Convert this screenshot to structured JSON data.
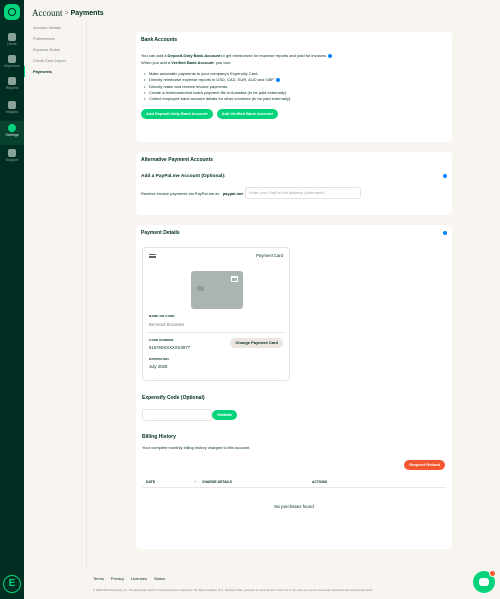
{
  "colors": {
    "accent": "#03d47c",
    "danger": "#f25730",
    "dark": "#002e22",
    "background": "#f8f4f0"
  },
  "nav": {
    "items": [
      {
        "label": "Home",
        "icon": "home-icon"
      },
      {
        "label": "Expenses",
        "icon": "receipt-icon"
      },
      {
        "label": "Reports",
        "icon": "document-icon"
      },
      {
        "label": "Insights",
        "icon": "lightbulb-icon"
      },
      {
        "label": "Settings",
        "icon": "gear-icon",
        "active": true
      },
      {
        "label": "Support",
        "icon": "chat-icon"
      }
    ]
  },
  "header": {
    "section": "Account",
    "separator": ">",
    "page": "Payments"
  },
  "submenu": [
    "Account Details",
    "Preferences",
    "Expense Rules",
    "Credit Card Import",
    "Payments"
  ],
  "bank": {
    "title": "Bank Accounts",
    "line1_a": "You can add a ",
    "line1_b": "Deposit-Only Bank Account",
    "line1_c": " to get reimbursed for expense reports and paid for invoices.",
    "line2_a": "When you add a ",
    "line2_b": "Verified Bank Account",
    "line2_c": ", you can:",
    "bullets": [
      "Make automatic payments to your company's Expensify Card.",
      "Directly reimburse expense reports in USD, CAD, EUR, AUD and GBP",
      "Directly make and receive invoice payments.",
      "Create a reimbursement batch payment file in Australia (to be paid externally).",
      "Collect employee bank account details for other countries (to be paid externally)."
    ],
    "btn_deposit": "Add Deposit-Only Bank Account",
    "btn_verified": "Add Verified Bank Account"
  },
  "alt": {
    "title": "Alternative Payment Accounts",
    "subtitle": "Add a PayPal.me Account (Optional):",
    "receive": "Receive invoice payments via PayPal.me at:",
    "prefix": "paypal.me/",
    "placeholder": "enter your PayPal.me address (username)"
  },
  "payment": {
    "title": "Payment Details",
    "card_title": "Payment Card",
    "name_label": "NAME ON CARD",
    "name_value": "Bertrand Bruandet",
    "number_label": "CARD NUMBER",
    "number_value": "516760XXXXXX3977",
    "exp_label": "EXPIRATION",
    "exp_value": "July 2029",
    "change_btn": "Change Payment Card",
    "code_title": "Expensify Code (Optional)",
    "validate_btn": "Validate",
    "billing_title": "Billing History",
    "billing_desc": "Your complete monthly billing history charged to this account.",
    "request_btn": "Request Refund",
    "col_date": "DATE",
    "col_sort": "⌄",
    "col_charge": "CHARGE DETAILS",
    "col_actions": "ACTIONS",
    "empty": "No purchases found"
  },
  "footer": {
    "links": [
      "Terms",
      "Privacy",
      "Licenses",
      "Status"
    ],
    "legal": "© 2008-2024 Expensify, Inc. The Expensify Visa® Commercial Card is issued by The Bancorp Bank, N.A., Member FDIC, pursuant to a license from Visa U.S.A. Inc. and may not be used at all merchants that accept Visa cards."
  }
}
